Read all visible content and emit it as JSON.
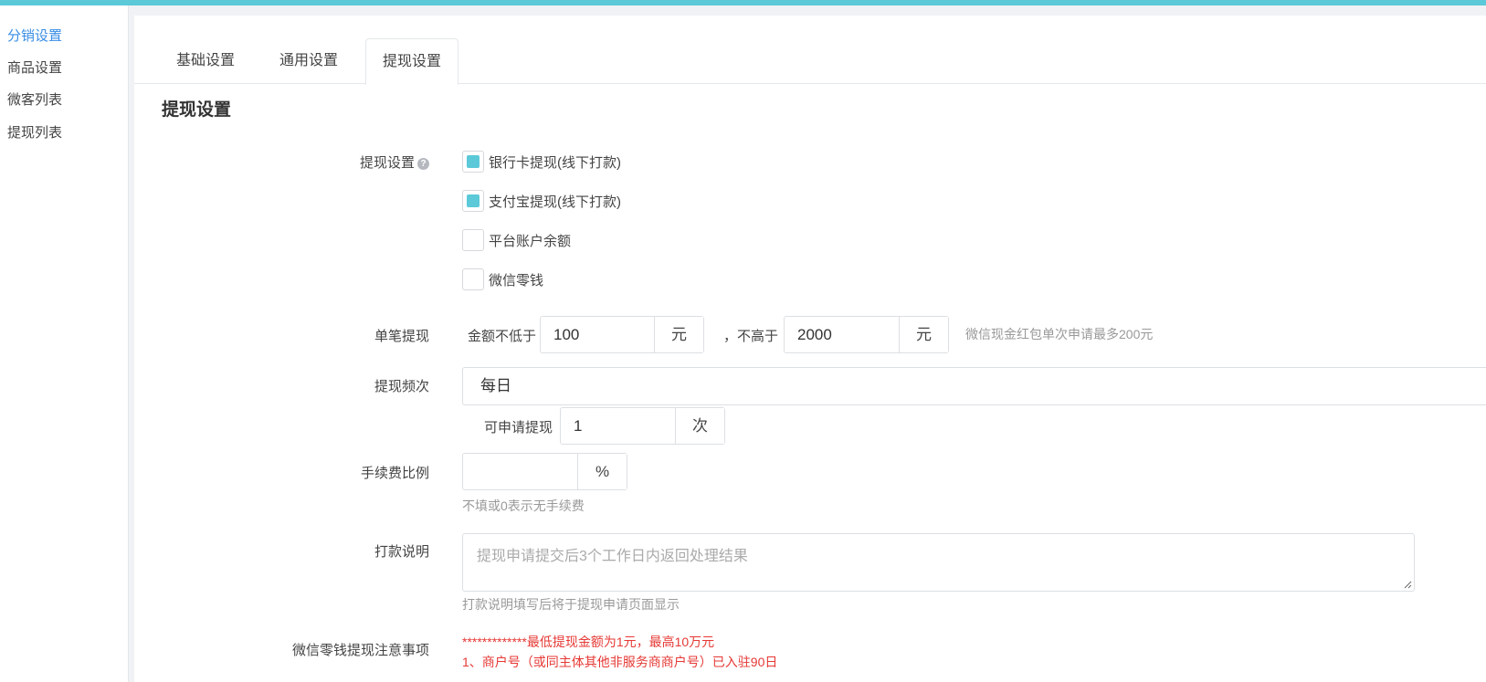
{
  "sidebar": {
    "items": [
      {
        "label": "分销设置",
        "active": true
      },
      {
        "label": "商品设置",
        "active": false
      },
      {
        "label": "微客列表",
        "active": false
      },
      {
        "label": "提现列表",
        "active": false
      }
    ]
  },
  "tabs": [
    {
      "label": "基础设置",
      "active": false
    },
    {
      "label": "通用设置",
      "active": false
    },
    {
      "label": "提现设置",
      "active": true
    }
  ],
  "section_title": "提现设置",
  "form": {
    "withdraw_methods": {
      "label": "提现设置",
      "help_icon": "question-circle-icon",
      "options": [
        {
          "label": "银行卡提现(线下打款)",
          "checked": true
        },
        {
          "label": "支付宝提现(线下打款)",
          "checked": true
        },
        {
          "label": "平台账户余额",
          "checked": false
        },
        {
          "label": "微信零钱",
          "checked": false
        }
      ]
    },
    "single_withdraw": {
      "label": "单笔提现",
      "min_prefix": "金额不低于",
      "min_value": "100",
      "min_unit": "元",
      "max_prefix": "，不高于",
      "max_value": "2000",
      "max_unit": "元",
      "hint": "微信现金红包单次申请最多200元"
    },
    "frequency": {
      "label": "提现频次",
      "selected": "每日",
      "count_prefix": "可申请提现",
      "count_value": "1",
      "count_unit": "次"
    },
    "fee_ratio": {
      "label": "手续费比例",
      "value": "",
      "unit": "%",
      "hint": "不填或0表示无手续费"
    },
    "payment_note": {
      "label": "打款说明",
      "placeholder": "提现申请提交后3个工作日内返回处理结果",
      "hint": "打款说明填写后将于提现申请页面显示"
    },
    "wechat_notice": {
      "label": "微信零钱提现注意事项",
      "line1": "*************最低提现金额为1元，最高10万元",
      "line2": "1、商户号（或同主体其他非服务商商户号）已入驻90日"
    }
  },
  "colors": {
    "accent": "#5bc9d8",
    "active_link": "#3a8ee6",
    "warning": "#e53935"
  }
}
